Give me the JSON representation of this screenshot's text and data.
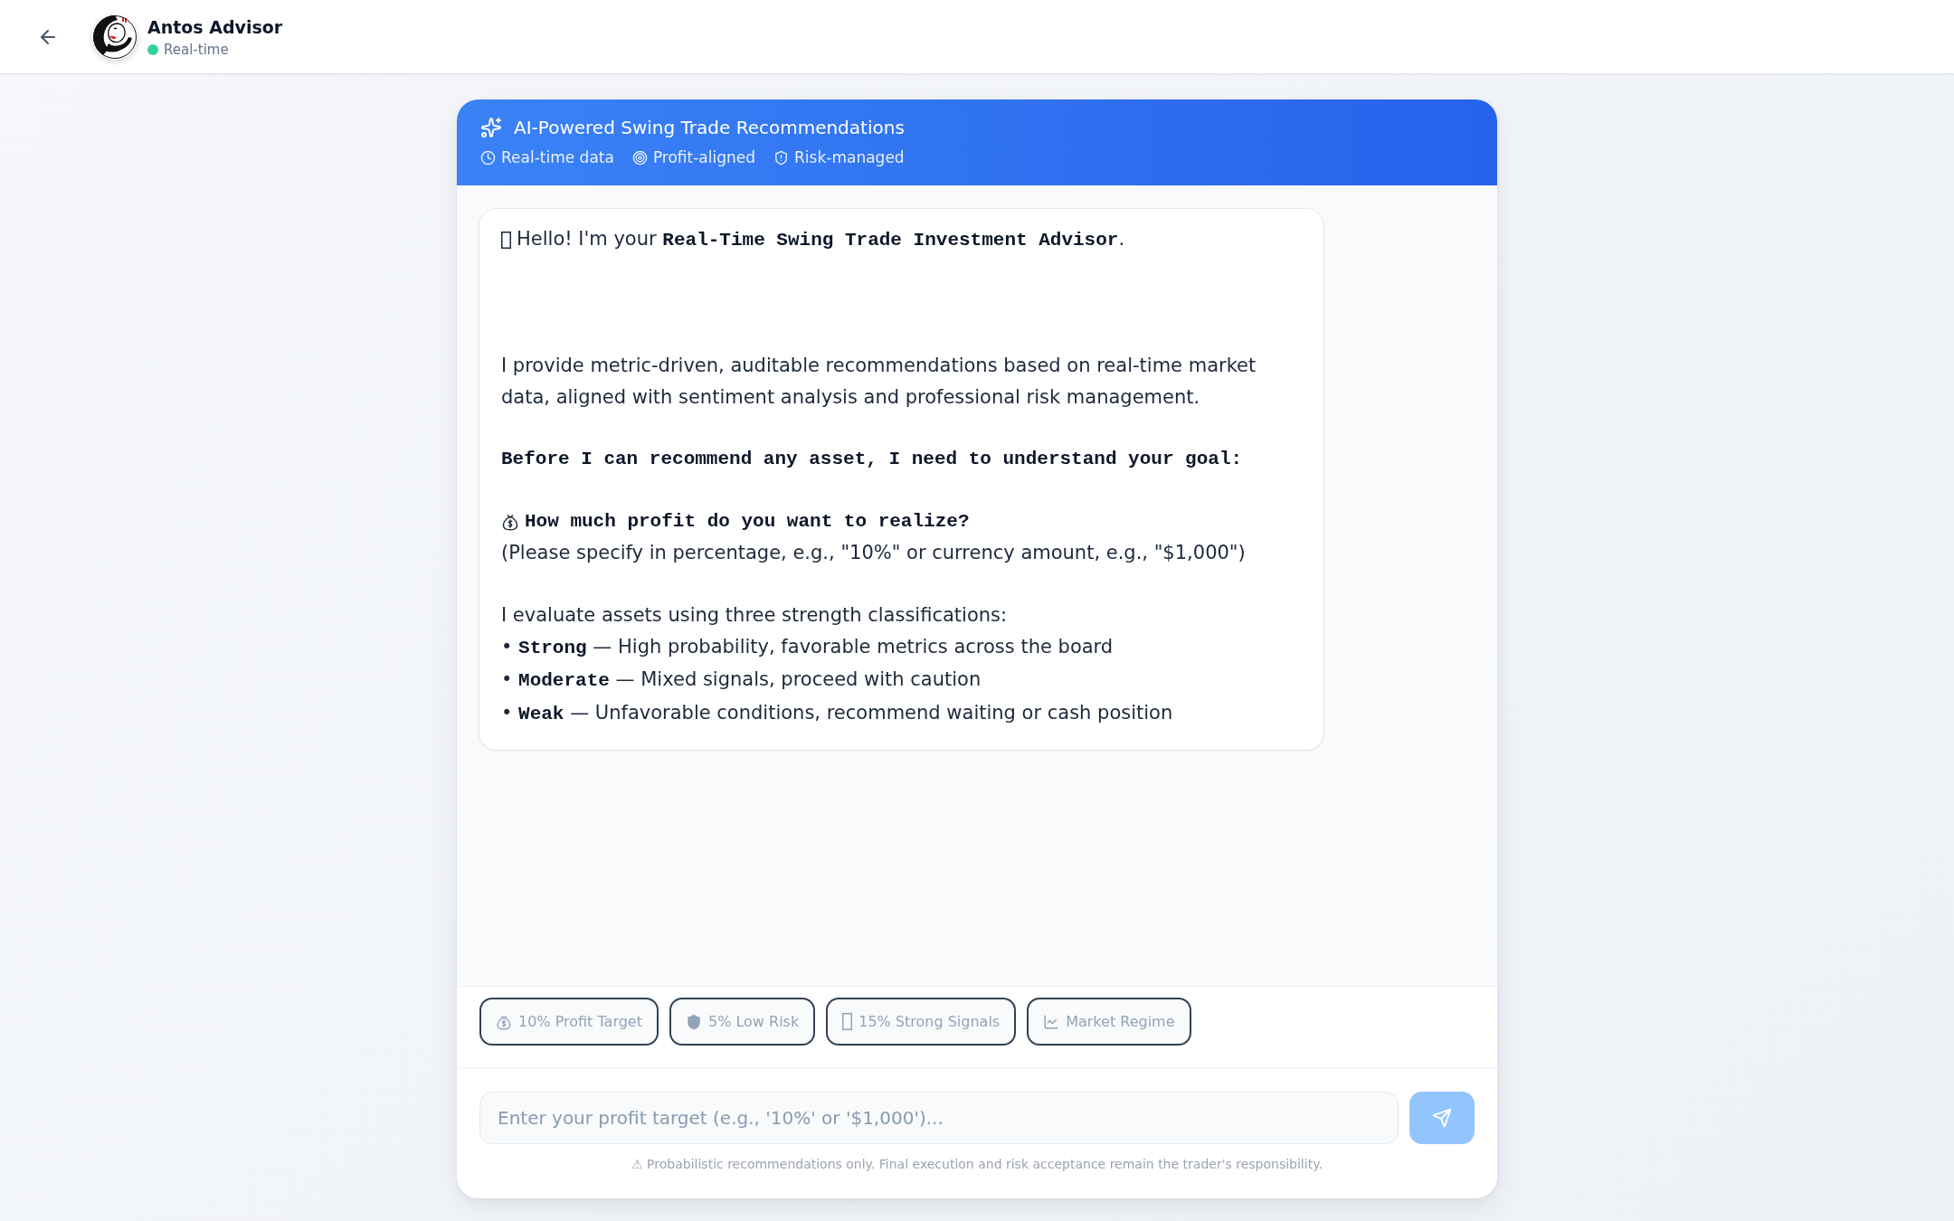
{
  "header": {
    "title": "Antos Advisor",
    "status": {
      "text": "Real-time",
      "live": true
    }
  },
  "advisor_card": {
    "title": "AI-Powered Swing Trade Recommendations",
    "features": [
      "Real-time data",
      "Profit-aligned",
      "Risk-managed"
    ],
    "message": {
      "paragraphs": [
        {
          "lines": [
            {
              "kind": "greeting",
              "text": "Hello! I'm your **Real-Time Swing Trade Investment Advisor**."
            }
          ]
        },
        {
          "lines": [
            {
              "kind": "text",
              "text": "I provide metric-driven, auditable recommendations based on real-time market data, aligned with sentiment analysis and professional risk management."
            }
          ]
        },
        {
          "lines": [
            {
              "kind": "heading",
              "text": "Before I can recommend any asset, I need to understand your goal:"
            }
          ]
        },
        {
          "lines": [
            {
              "kind": "question",
              "text": "How much profit do you want to realize?"
            },
            {
              "kind": "text",
              "text": "(Please specify in percentage, e.g., \"10%\" or currency amount, e.g., \"$1,000\")"
            }
          ]
        },
        {
          "lines": [
            {
              "kind": "text",
              "text": "I evaluate assets using three strength classifications:"
            },
            {
              "kind": "text",
              "text": "• **Strong** — High probability, favorable metrics across the board"
            },
            {
              "kind": "text",
              "text": "• **Moderate** — Mixed signals, proceed with caution"
            },
            {
              "kind": "text",
              "text": "• **Weak** — Unfavorable conditions, recommend waiting or cash position"
            }
          ]
        }
      ]
    },
    "quick_replies": [
      "10% Profit Target",
      "5% Low Risk",
      "15% Strong Signals",
      "Market Regime"
    ],
    "input": {
      "placeholder": "Enter your profit target (e.g., '10%' or '$1,000')..."
    },
    "send_button": {
      "disabled": true
    },
    "disclaimer": "⚠ Probabilistic recommendations only. Final execution and risk acceptance remain the trader's responsibility."
  }
}
